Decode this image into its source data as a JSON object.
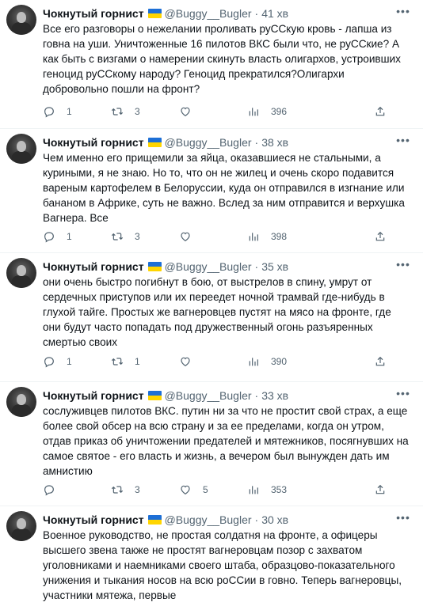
{
  "tweets": [
    {
      "name": "Чокнутый горнист",
      "handle": "@Buggy__Bugler",
      "dot": "·",
      "time": "41 хв",
      "text": "Все его разговоры о нежелании проливать руССкую кровь - лапша из говна на уши. Уничтоженные 16 пилотов ВКС были что, не руССкие? А как быть с визгами о намерении скинуть власть олигархов, устроивших геноцид руССкому народу? Геноцид прекратился?Олигархи добровольно пошли на фронт?",
      "replies": "1",
      "retweets": "3",
      "likes": "",
      "views": "396"
    },
    {
      "name": "Чокнутый горнист",
      "handle": "@Buggy__Bugler",
      "dot": "·",
      "time": "38 хв",
      "text": "Чем именно его прищемили за яйца, оказавшиеся не стальными, а куриными, я не знаю. Но то, что он не жилец и очень скоро подавится вареным картофелем в Белоруссии, куда он отправился в изгнание или бананом в Африке, суть не важно. Вслед за ним отправится и верхушка Вагнера. Все",
      "replies": "1",
      "retweets": "3",
      "likes": "",
      "views": "398"
    },
    {
      "name": "Чокнутый горнист",
      "handle": "@Buggy__Bugler",
      "dot": "·",
      "time": "35 хв",
      "text": "они очень быстро погибнут в бою, от выстрелов в спину, умрут от сердечных приступов или их переедет ночной трамвай где-нибудь в глухой тайге. Простых же вагнеровцев пустят на мясо на фронте, где они будут часто попадать под дружественный огонь разъяренных смертью своих",
      "replies": "1",
      "retweets": "1",
      "likes": "",
      "views": "390"
    },
    {
      "name": "Чокнутый горнист",
      "handle": "@Buggy__Bugler",
      "dot": "·",
      "time": "33 хв",
      "text": "сослуживцев пилотов ВКС. путин ни за что не простит свой страх, а еще более свой обсер на всю страну и за ее пределами, когда он утром, отдав приказ об уничтожении предателей и мятежников, посягнувших на самое святое - его власть и жизнь, а вечером был вынужден дать им амнистию",
      "replies": "",
      "retweets": "3",
      "likes": "5",
      "views": "353"
    },
    {
      "name": "Чокнутый горнист",
      "handle": "@Buggy__Bugler",
      "dot": "·",
      "time": "30 хв",
      "text": "Военное руководство, не простая солдатня на фронте, а офицеры высшего звена также не простят вагнеровцам позор с захватом уголовниками и наемниками своего штаба, образцово-показательного унижения и тыкания носов на всю роССии в говно. Теперь вагнеровцы, участники мятежа, первые",
      "replies": "",
      "retweets": "",
      "likes": "",
      "views": ""
    }
  ],
  "icons": {
    "reply": "reply-icon",
    "retweet": "retweet-icon",
    "like": "like-icon",
    "views": "views-icon",
    "share": "share-icon",
    "more": "more-icon"
  }
}
